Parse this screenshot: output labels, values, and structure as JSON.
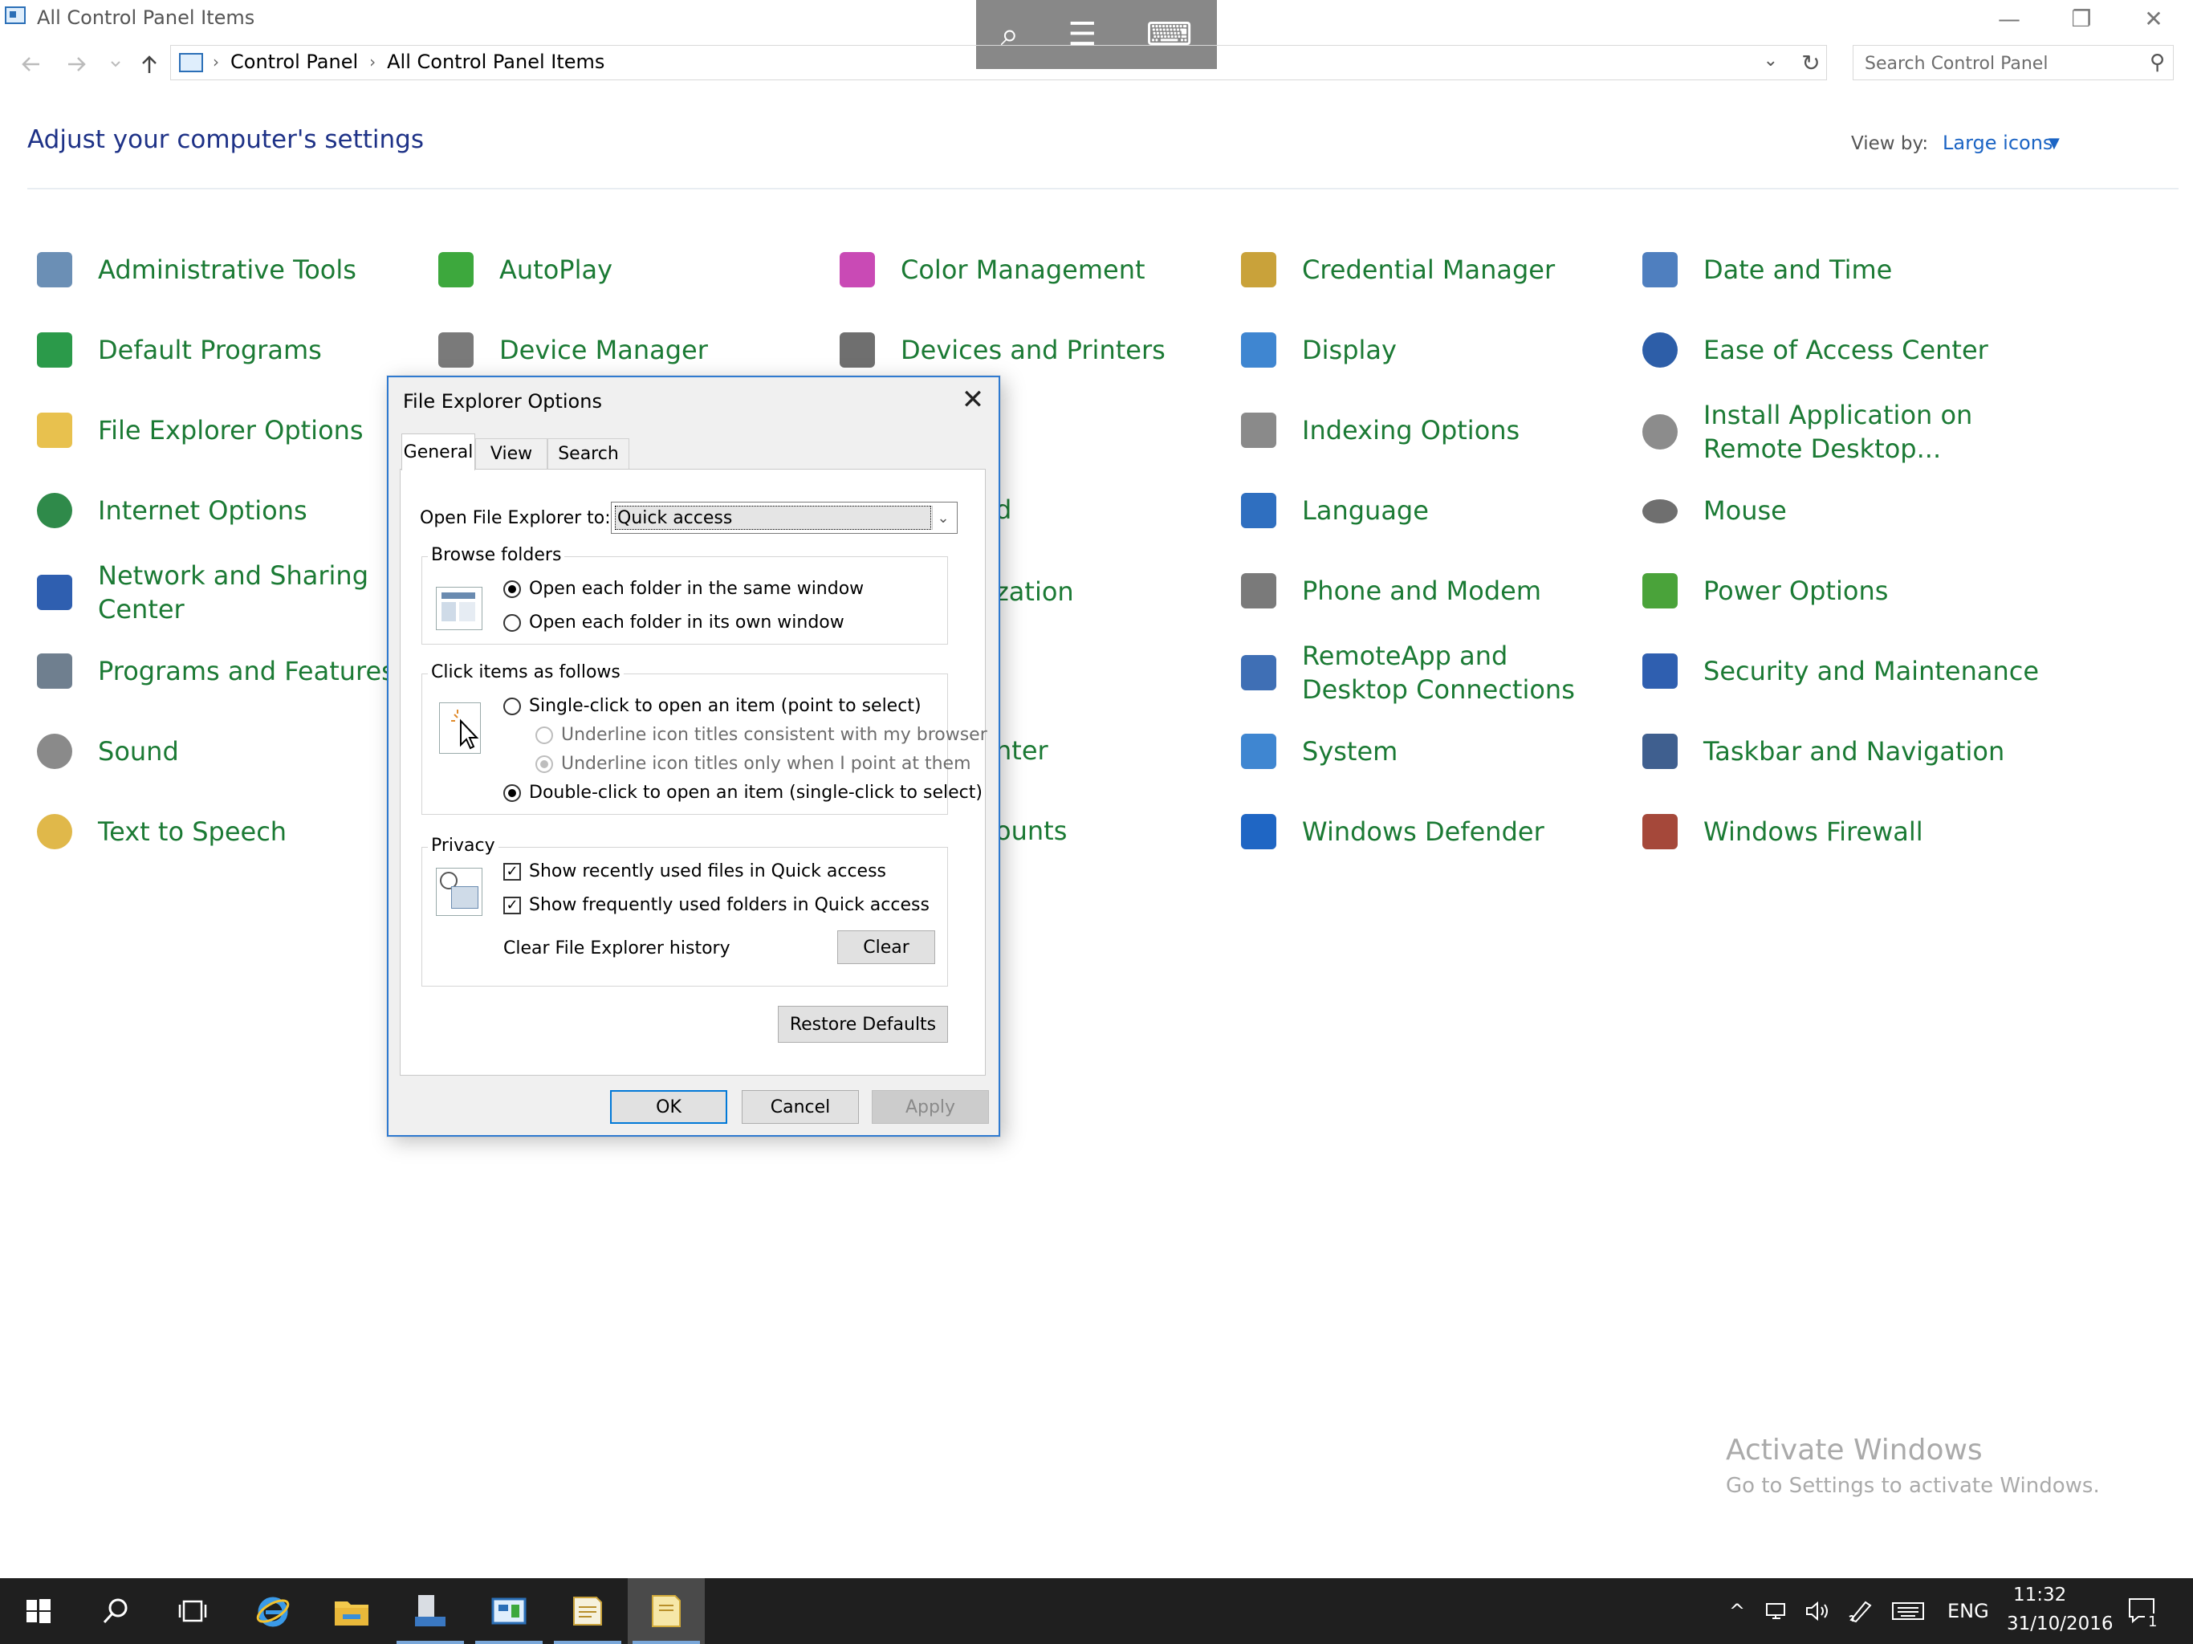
{
  "window": {
    "title": "All Control Panel Items",
    "minimize": "—",
    "restore": "❐",
    "close": "✕"
  },
  "touch_toolbar": {
    "zoom": "⌕",
    "menu": "☰",
    "keyboard": "⌨"
  },
  "address": {
    "crumbs": [
      "Control Panel",
      "All Control Panel Items"
    ],
    "separator": "›",
    "dropdown": "⌄",
    "refresh": "↻"
  },
  "search": {
    "placeholder": "Search Control Panel",
    "icon": "⚲"
  },
  "header": {
    "title": "Adjust your computer's settings",
    "view_by_label": "View by:",
    "view_by_value": "Large icons",
    "caret": "▼"
  },
  "items": [
    {
      "label": "Administrative Tools",
      "icon": "admin-tools-icon",
      "color": "#6b8fb5"
    },
    {
      "label": "AutoPlay",
      "icon": "autoplay-icon",
      "color": "#3da83d"
    },
    {
      "label": "Color Management",
      "icon": "color-management-icon",
      "color": "#c94ab5"
    },
    {
      "label": "Credential Manager",
      "icon": "credential-manager-icon",
      "color": "#c9a23a"
    },
    {
      "label": "Date and Time",
      "icon": "date-time-icon",
      "color": "#4f7fbf"
    },
    {
      "label": "Default Programs",
      "icon": "default-programs-icon",
      "color": "#2b9a4a"
    },
    {
      "label": "Device Manager",
      "icon": "device-manager-icon",
      "color": "#7a7a7a"
    },
    {
      "label": "Devices and Printers",
      "icon": "devices-printers-icon",
      "color": "#6f6f6f"
    },
    {
      "label": "Display",
      "icon": "display-icon",
      "color": "#3f86d1"
    },
    {
      "label": "Ease of Access Center",
      "icon": "ease-of-access-icon",
      "color": "#2d5ea8"
    },
    {
      "label": "File Explorer Options",
      "icon": "folder-options-icon",
      "color": "#e8c14e"
    },
    {
      "label": "Indexing Options",
      "icon": "indexing-options-icon",
      "color": "#8a8a8a"
    },
    {
      "label": "Install Application on Remote Desktop...",
      "icon": "install-remote-app-icon",
      "color": "#8c8c8c"
    },
    {
      "label": "Internet Options",
      "icon": "internet-options-icon",
      "color": "#2f8a4a"
    },
    {
      "label": "Language",
      "icon": "language-icon",
      "color": "#2f6fc0"
    },
    {
      "label": "Mouse",
      "icon": "mouse-icon",
      "color": "#6f6f6f"
    },
    {
      "label": "Network and Sharing Center",
      "icon": "network-sharing-icon",
      "color": "#2f5fb0"
    },
    {
      "label": "zation",
      "icon": "",
      "color": ""
    },
    {
      "label": "Phone and Modem",
      "icon": "phone-modem-icon",
      "color": "#7a7a7a"
    },
    {
      "label": "Power Options",
      "icon": "power-options-icon",
      "color": "#4aa33a"
    },
    {
      "label": "Programs and Features",
      "icon": "programs-features-icon",
      "color": "#6f7f8f"
    },
    {
      "label": "RemoteApp and Desktop Connections",
      "icon": "remoteapp-icon",
      "color": "#3f6fb5"
    },
    {
      "label": "Security and Maintenance",
      "icon": "security-maintenance-icon",
      "color": "#2f5fb0"
    },
    {
      "label": "Sound",
      "icon": "sound-icon",
      "color": "#8a8a8a"
    },
    {
      "label": "nter",
      "icon": "",
      "color": ""
    },
    {
      "label": "System",
      "icon": "system-icon",
      "color": "#3f86d1"
    },
    {
      "label": "Taskbar and Navigation",
      "icon": "taskbar-navigation-icon",
      "color": "#3f5f8f"
    },
    {
      "label": "Text to Speech",
      "icon": "text-to-speech-icon",
      "color": "#e0b84a"
    },
    {
      "label": "ounts",
      "icon": "",
      "color": ""
    },
    {
      "label": "Windows Defender",
      "icon": "windows-defender-icon",
      "color": "#1f66c4"
    },
    {
      "label": "Windows Firewall",
      "icon": "windows-firewall-icon",
      "color": "#a5483a"
    },
    {
      "label": "d",
      "icon": "",
      "color": ""
    }
  ],
  "dialog": {
    "title": "File Explorer Options",
    "close": "✕",
    "tabs": [
      "General",
      "View",
      "Search"
    ],
    "open_to_label": "Open File Explorer to:",
    "open_to_value": "Quick access",
    "open_to_caret": "⌄",
    "browse_group": "Browse folders",
    "browse_same": "Open each folder in the same window",
    "browse_own": "Open each folder in its own window",
    "click_group": "Click items as follows",
    "single_click": "Single-click to open an item (point to select)",
    "underline_browser": "Underline icon titles consistent with my browser",
    "underline_point": "Underline icon titles only when I point at them",
    "double_click": "Double-click to open an item (single-click to select)",
    "privacy_group": "Privacy",
    "recent_files": "Show recently used files in Quick access",
    "frequent_folders": "Show frequently used folders in Quick access",
    "clear_history_label": "Clear File Explorer history",
    "clear_button": "Clear",
    "restore_button": "Restore Defaults",
    "ok_button": "OK",
    "cancel_button": "Cancel",
    "apply_button": "Apply",
    "check_mark": "✓"
  },
  "watermark": {
    "line1": "Activate Windows",
    "line2": "Go to Settings to activate Windows."
  },
  "taskbar": {
    "start": "⊞",
    "search": "⚲",
    "task_view": "❏",
    "tray_chevron": "^",
    "language": "ENG",
    "time": "11:32",
    "date": "31/10/2016",
    "notifications": "1"
  }
}
